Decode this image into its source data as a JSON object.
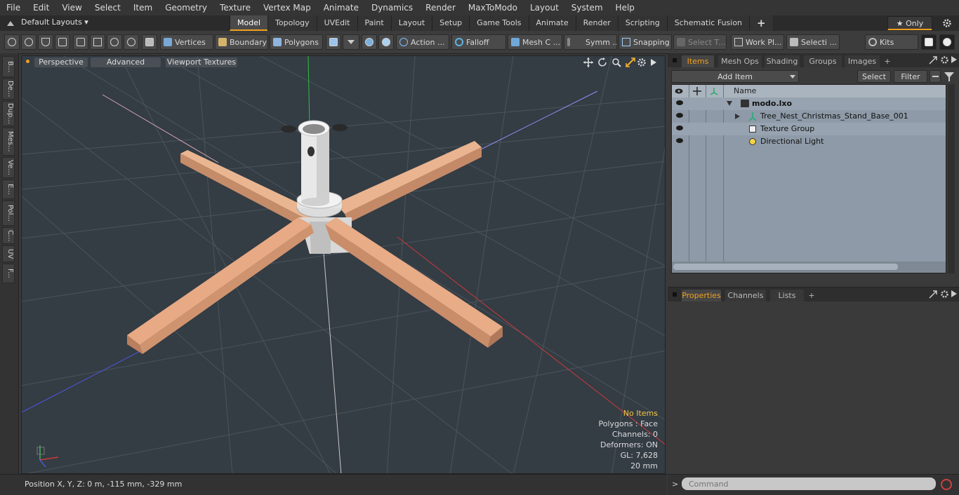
{
  "menu": [
    "File",
    "Edit",
    "View",
    "Select",
    "Item",
    "Geometry",
    "Texture",
    "Vertex Map",
    "Animate",
    "Dynamics",
    "Render",
    "MaxToModo",
    "Layout",
    "System",
    "Help"
  ],
  "layout": {
    "selector": "Default Layouts ▾",
    "tabs": [
      "Model",
      "Topology",
      "UVEdit",
      "Paint",
      "Layout",
      "Setup",
      "Game Tools",
      "Animate",
      "Render",
      "Scripting",
      "Schematic Fusion"
    ],
    "active_tab": "Model",
    "add_tab": "+",
    "only_label": "★ Only"
  },
  "toolbar": {
    "vertices": "Vertices",
    "boundary": "Boundary",
    "polygons": "Polygons",
    "action": "Action ...",
    "falloff": "Falloff",
    "mesh": "Mesh C ...",
    "symmetry": "Symm ...",
    "snapping": "Snapping",
    "select_t": "Select T...",
    "work_plane": "Work Pl...",
    "selection": "Selecti ...",
    "kits": "Kits"
  },
  "left_tabs": [
    "B...",
    "De...",
    "Dup...",
    "Mes...",
    "Ve...",
    "E...",
    "Pol...",
    "C...",
    "UV",
    "F..."
  ],
  "viewport": {
    "tabs": [
      "Perspective",
      "Advanced",
      "Viewport Textures"
    ],
    "info": {
      "no_items": "No Items",
      "polygons": "Polygons : Face",
      "channels": "Channels: 0",
      "deformers": "Deformers: ON",
      "gl": "GL: 7,628",
      "scale": "20 mm"
    }
  },
  "status": {
    "position": "Position X, Y, Z:   0 m, -115 mm, -329 mm"
  },
  "items_panel": {
    "tabs": [
      "Items",
      "Mesh Ops",
      "Shading",
      "Groups",
      "Images"
    ],
    "active": "Items",
    "add": "+",
    "add_item": "Add Item",
    "select": "Select",
    "filter": "Filter",
    "name_header": "Name",
    "tree": [
      "modo.lxo",
      "Tree_Nest_Christmas_Stand_Base_001",
      "Texture Group",
      "Directional Light"
    ]
  },
  "props_panel": {
    "tabs": [
      "Properties",
      "Channels",
      "Lists"
    ],
    "active": "Properties",
    "add": "+"
  },
  "command": {
    "placeholder": "Command",
    "prompt": ">"
  },
  "colors": {
    "accent": "#f0a020",
    "wood": "#e7aa85",
    "viewport_bg": "#343c44",
    "tree_bg": "#8e9aa7"
  }
}
